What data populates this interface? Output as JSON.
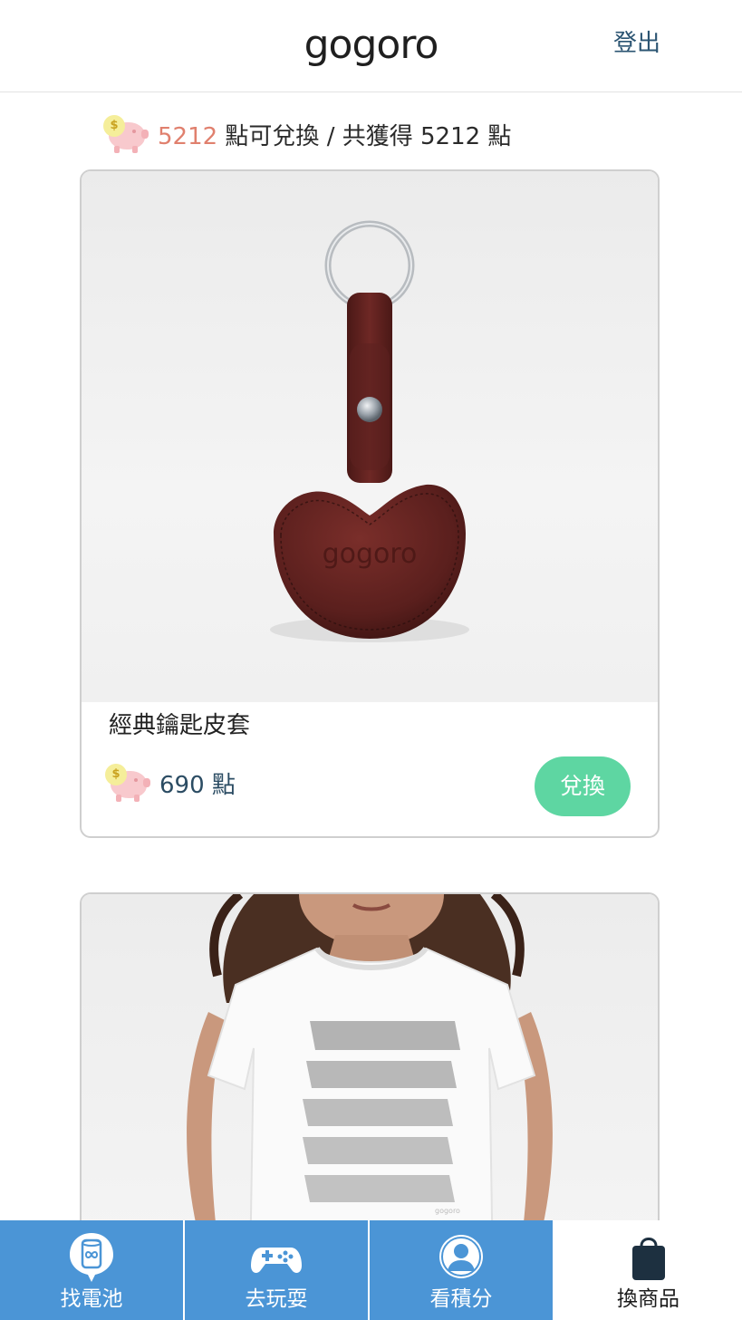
{
  "header": {
    "logo": "gogoro",
    "logout_label": "登出"
  },
  "points": {
    "available": "5212",
    "text_after": " 點可兌換 / 共獲得 5212 點",
    "coin_symbol": "$"
  },
  "products": [
    {
      "name": "經典鑰匙皮套",
      "price_text": "690 點",
      "redeem_label": "兌換",
      "image_logo": "gogoro"
    },
    {
      "name": "",
      "price_text": "",
      "redeem_label": "",
      "image_tag": "gogoro"
    }
  ],
  "bottom_nav": [
    {
      "label": "找電池",
      "icon": "battery-pin-icon",
      "active": false
    },
    {
      "label": "去玩耍",
      "icon": "gamepad-icon",
      "active": false
    },
    {
      "label": "看積分",
      "icon": "user-circle-icon",
      "active": false
    },
    {
      "label": "換商品",
      "icon": "shopping-bag-icon",
      "active": true
    }
  ],
  "colors": {
    "accent_points": "#e0806e",
    "redeem_button": "#5ed6a2",
    "nav_background": "#4b95d6",
    "logout_text": "#2b5472"
  }
}
